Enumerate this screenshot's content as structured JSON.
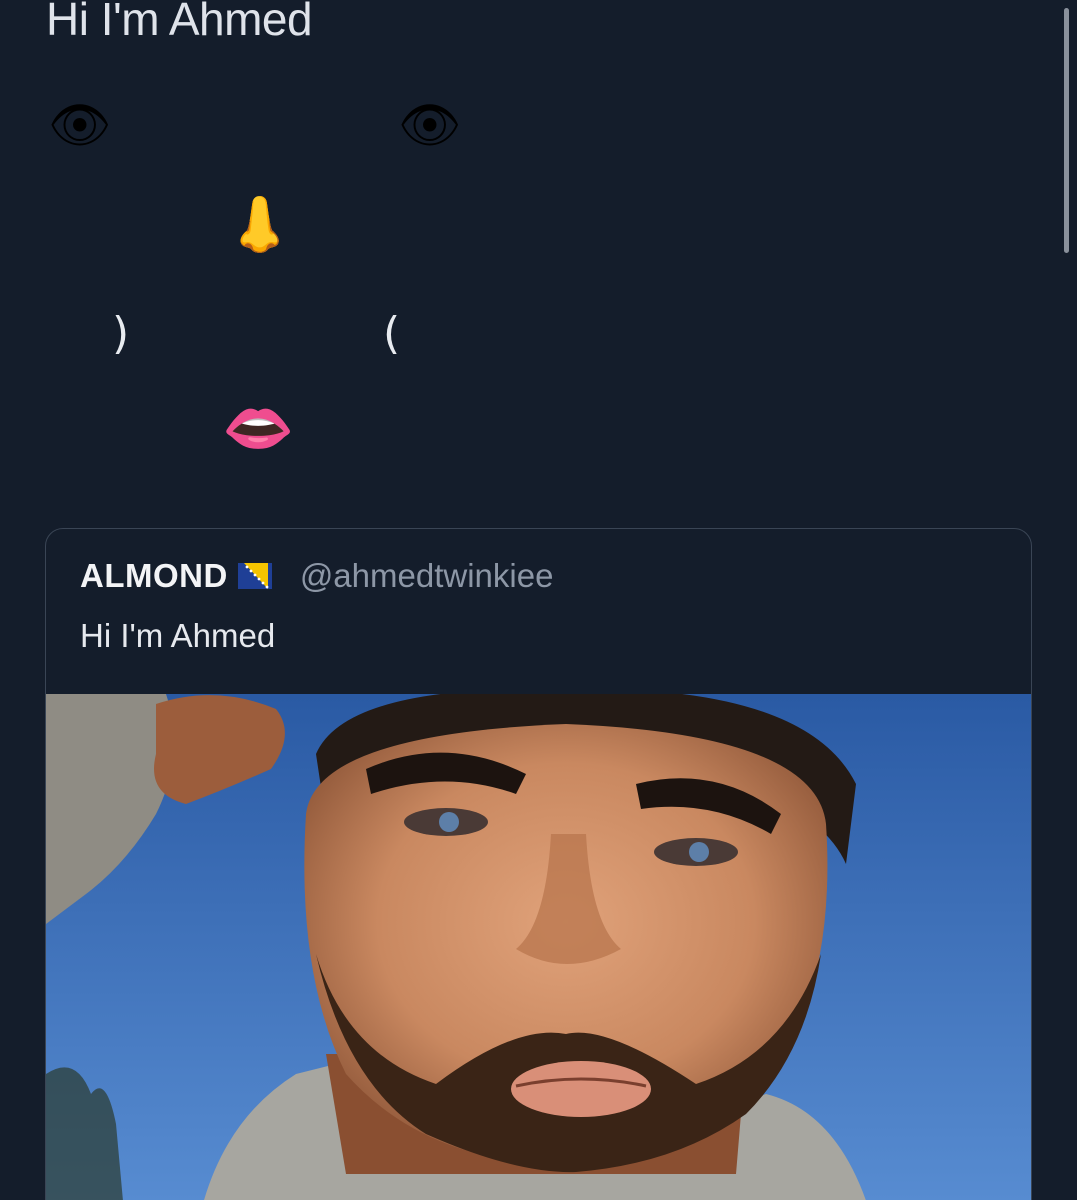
{
  "tweet": {
    "text": "Hi I'm Ahmed",
    "face": {
      "eye": "👁",
      "nose": "👃",
      "mouth": "👄",
      "left_cheek": ")",
      "right_cheek": "("
    }
  },
  "quoted_tweet": {
    "display_name": "ALMOND",
    "flag_icon": "bosnia-flag-icon",
    "handle": "@ahmedtwinkiee",
    "text": "Hi I'm Ahmed",
    "media": "selfie-photo"
  },
  "colors": {
    "background": "#141d2b",
    "card_border": "#3a4555",
    "handle": "#8d97a6",
    "sky": "#2f5ea6"
  }
}
